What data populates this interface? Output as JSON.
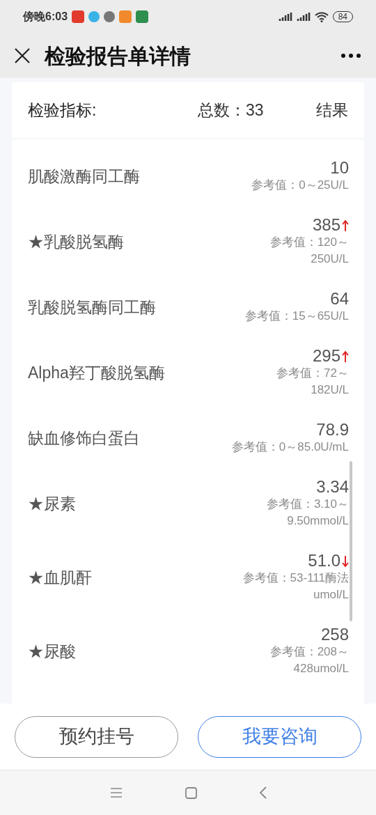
{
  "status_bar": {
    "time": "傍晚6:03",
    "battery": "84"
  },
  "header": {
    "title": "检验报告单详情"
  },
  "summary": {
    "label": "检验指标:",
    "total": "总数：33",
    "result": "结果"
  },
  "items": [
    {
      "name": "肌酸激酶同工酶",
      "value": "10",
      "reference": [
        "参考值：0～25U/L"
      ]
    },
    {
      "name": "★乳酸脱氢酶",
      "value": "385",
      "high": true,
      "reference": [
        "参考值：120～",
        "250U/L"
      ]
    },
    {
      "name": "乳酸脱氢酶同工酶",
      "value": "64",
      "reference": [
        "参考值：15～65U/L"
      ]
    },
    {
      "name": "Alpha羟丁酸脱氢酶",
      "value": "295",
      "high": true,
      "reference": [
        "参考值：72～",
        "182U/L"
      ]
    },
    {
      "name": "缺血修饰白蛋白",
      "value": "78.9",
      "reference": [
        "参考值：0～85.0U/mL"
      ]
    },
    {
      "name": "★尿素",
      "value": "3.34",
      "reference": [
        "参考值：3.10～",
        "9.50mmol/L"
      ]
    },
    {
      "name": "★血肌酐",
      "value": "51.0",
      "low": true,
      "reference": [
        "参考值：53-111酶法",
        "umol/L"
      ]
    },
    {
      "name": "★尿酸",
      "value": "258",
      "reference": [
        "参考值：208～",
        "428umol/L"
      ]
    }
  ],
  "buttons": [
    {
      "label": "预约挂号",
      "kind": "secondary"
    },
    {
      "label": "我要咨询",
      "kind": "primary"
    }
  ]
}
